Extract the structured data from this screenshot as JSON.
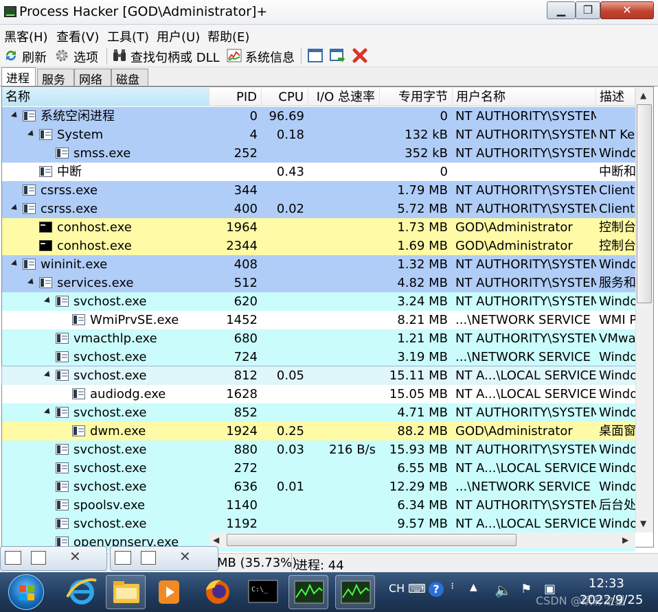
{
  "window": {
    "title": "Process Hacker [GOD\\Administrator]+",
    "min_label": "▁",
    "max_label": "❐",
    "close_label": "✕"
  },
  "menu": [
    "黑客(H)",
    "查看(V)",
    "工具(T)",
    "用户(U)",
    "帮助(E)"
  ],
  "toolbar": {
    "refresh": "刷新",
    "options": "选项",
    "find": "查找句柄或 DLL",
    "sysinfo": "系统信息"
  },
  "tabs": [
    "进程",
    "服务",
    "网络",
    "磁盘"
  ],
  "columns": [
    "名称",
    "PID",
    "CPU",
    "I/O 总速率",
    "专用字节",
    "用户名称",
    "描述"
  ],
  "rows": [
    {
      "name": "系统空闲进程",
      "pid": "0",
      "cpu": "96.69",
      "io": "",
      "mem": "0",
      "user": "NT AUTHORITY\\SYSTEM",
      "desc": "",
      "color": "blue",
      "level": 0,
      "expand": true,
      "icon": "window-icon"
    },
    {
      "name": "System",
      "pid": "4",
      "cpu": "0.18",
      "io": "",
      "mem": "132 kB",
      "user": "NT AUTHORITY\\SYSTEM",
      "desc": "NT Kernel",
      "color": "blue",
      "level": 1,
      "expand": true,
      "icon": "window-icon"
    },
    {
      "name": "smss.exe",
      "pid": "252",
      "cpu": "",
      "io": "",
      "mem": "352 kB",
      "user": "NT AUTHORITY\\SYSTEM",
      "desc": "Windows",
      "color": "blue",
      "level": 2,
      "expand": false,
      "icon": "window-icon"
    },
    {
      "name": "中断",
      "pid": "",
      "cpu": "0.43",
      "io": "",
      "mem": "0",
      "user": "",
      "desc": "中断和",
      "color": "white",
      "level": 1,
      "expand": false,
      "icon": "window-icon"
    },
    {
      "name": "csrss.exe",
      "pid": "344",
      "cpu": "",
      "io": "",
      "mem": "1.79 MB",
      "user": "NT AUTHORITY\\SYSTEM",
      "desc": "Client",
      "color": "blue",
      "level": 0,
      "expand": false,
      "icon": "window-icon"
    },
    {
      "name": "csrss.exe",
      "pid": "400",
      "cpu": "0.02",
      "io": "",
      "mem": "5.72 MB",
      "user": "NT AUTHORITY\\SYSTEM",
      "desc": "Client",
      "color": "blue",
      "level": 0,
      "expand": true,
      "icon": "window-icon"
    },
    {
      "name": "conhost.exe",
      "pid": "1964",
      "cpu": "",
      "io": "",
      "mem": "1.73 MB",
      "user": "GOD\\Administrator",
      "desc": "控制台",
      "color": "yellow",
      "level": 1,
      "expand": false,
      "icon": "console-icon"
    },
    {
      "name": "conhost.exe",
      "pid": "2344",
      "cpu": "",
      "io": "",
      "mem": "1.69 MB",
      "user": "GOD\\Administrator",
      "desc": "控制台",
      "color": "yellow",
      "level": 1,
      "expand": false,
      "icon": "console-icon"
    },
    {
      "name": "wininit.exe",
      "pid": "408",
      "cpu": "",
      "io": "",
      "mem": "1.32 MB",
      "user": "NT AUTHORITY\\SYSTEM",
      "desc": "Windows",
      "color": "blue",
      "level": 0,
      "expand": true,
      "icon": "window-icon"
    },
    {
      "name": "services.exe",
      "pid": "512",
      "cpu": "",
      "io": "",
      "mem": "4.82 MB",
      "user": "NT AUTHORITY\\SYSTEM",
      "desc": "服务和",
      "color": "blue",
      "level": 1,
      "expand": true,
      "icon": "window-icon"
    },
    {
      "name": "svchost.exe",
      "pid": "620",
      "cpu": "",
      "io": "",
      "mem": "3.24 MB",
      "user": "NT AUTHORITY\\SYSTEM",
      "desc": "Windows",
      "color": "cyan",
      "level": 2,
      "expand": true,
      "icon": "window-icon"
    },
    {
      "name": "WmiPrvSE.exe",
      "pid": "1452",
      "cpu": "",
      "io": "",
      "mem": "8.21 MB",
      "user": "...\\NETWORK SERVICE",
      "desc": "WMI P",
      "color": "white",
      "level": 3,
      "expand": false,
      "icon": "window-icon"
    },
    {
      "name": "vmacthlp.exe",
      "pid": "680",
      "cpu": "",
      "io": "",
      "mem": "1.21 MB",
      "user": "NT AUTHORITY\\SYSTEM",
      "desc": "VMware",
      "color": "cyan",
      "level": 2,
      "expand": false,
      "icon": "window-icon"
    },
    {
      "name": "svchost.exe",
      "pid": "724",
      "cpu": "",
      "io": "",
      "mem": "3.19 MB",
      "user": "...\\NETWORK SERVICE",
      "desc": "Windows",
      "color": "cyan",
      "level": 2,
      "expand": false,
      "icon": "window-icon"
    },
    {
      "name": "svchost.exe",
      "pid": "812",
      "cpu": "0.05",
      "io": "",
      "mem": "15.11 MB",
      "user": "NT A...\\LOCAL SERVICE",
      "desc": "Windows",
      "color": "cyan",
      "level": 2,
      "expand": true,
      "icon": "window-icon",
      "selected": true
    },
    {
      "name": "audiodg.exe",
      "pid": "1628",
      "cpu": "",
      "io": "",
      "mem": "15.05 MB",
      "user": "NT A...\\LOCAL SERVICE",
      "desc": "Windows",
      "color": "white",
      "level": 3,
      "expand": false,
      "icon": "window-icon"
    },
    {
      "name": "svchost.exe",
      "pid": "852",
      "cpu": "",
      "io": "",
      "mem": "4.71 MB",
      "user": "NT AUTHORITY\\SYSTEM",
      "desc": "Windows",
      "color": "cyan",
      "level": 2,
      "expand": true,
      "icon": "window-icon"
    },
    {
      "name": "dwm.exe",
      "pid": "1924",
      "cpu": "0.25",
      "io": "",
      "mem": "88.2 MB",
      "user": "GOD\\Administrator",
      "desc": "桌面窗",
      "color": "yellow",
      "level": 3,
      "expand": false,
      "icon": "window-icon"
    },
    {
      "name": "svchost.exe",
      "pid": "880",
      "cpu": "0.03",
      "io": "216 B/s",
      "mem": "15.93 MB",
      "user": "NT AUTHORITY\\SYSTEM",
      "desc": "Windows",
      "color": "cyan",
      "level": 2,
      "expand": false,
      "icon": "window-icon"
    },
    {
      "name": "svchost.exe",
      "pid": "272",
      "cpu": "",
      "io": "",
      "mem": "6.55 MB",
      "user": "NT A...\\LOCAL SERVICE",
      "desc": "Windows",
      "color": "cyan",
      "level": 2,
      "expand": false,
      "icon": "window-icon"
    },
    {
      "name": "svchost.exe",
      "pid": "636",
      "cpu": "0.01",
      "io": "",
      "mem": "12.29 MB",
      "user": "...\\NETWORK SERVICE",
      "desc": "Windows",
      "color": "cyan",
      "level": 2,
      "expand": false,
      "icon": "window-icon"
    },
    {
      "name": "spoolsv.exe",
      "pid": "1140",
      "cpu": "",
      "io": "",
      "mem": "6.34 MB",
      "user": "NT AUTHORITY\\SYSTEM",
      "desc": "后台处",
      "color": "cyan",
      "level": 2,
      "expand": false,
      "icon": "window-icon"
    },
    {
      "name": "svchost.exe",
      "pid": "1192",
      "cpu": "",
      "io": "",
      "mem": "9.57 MB",
      "user": "NT A...\\LOCAL SERVICE",
      "desc": "Windows",
      "color": "cyan",
      "level": 2,
      "expand": false,
      "icon": "window-icon"
    },
    {
      "name": "openvpnserv.exe",
      "pid": "",
      "cpu": "",
      "io": "",
      "mem": "",
      "user": "",
      "desc": "",
      "color": "cyan",
      "level": 2,
      "expand": false,
      "icon": "window-icon"
    }
  ],
  "status": {
    "memory": "MB (35.73%)",
    "processes": "进程: 44"
  },
  "taskbar": {
    "lang": "CH",
    "time": "12:33",
    "date": "2022/9/25",
    "watermark": "CSDN @缤彩之星"
  }
}
